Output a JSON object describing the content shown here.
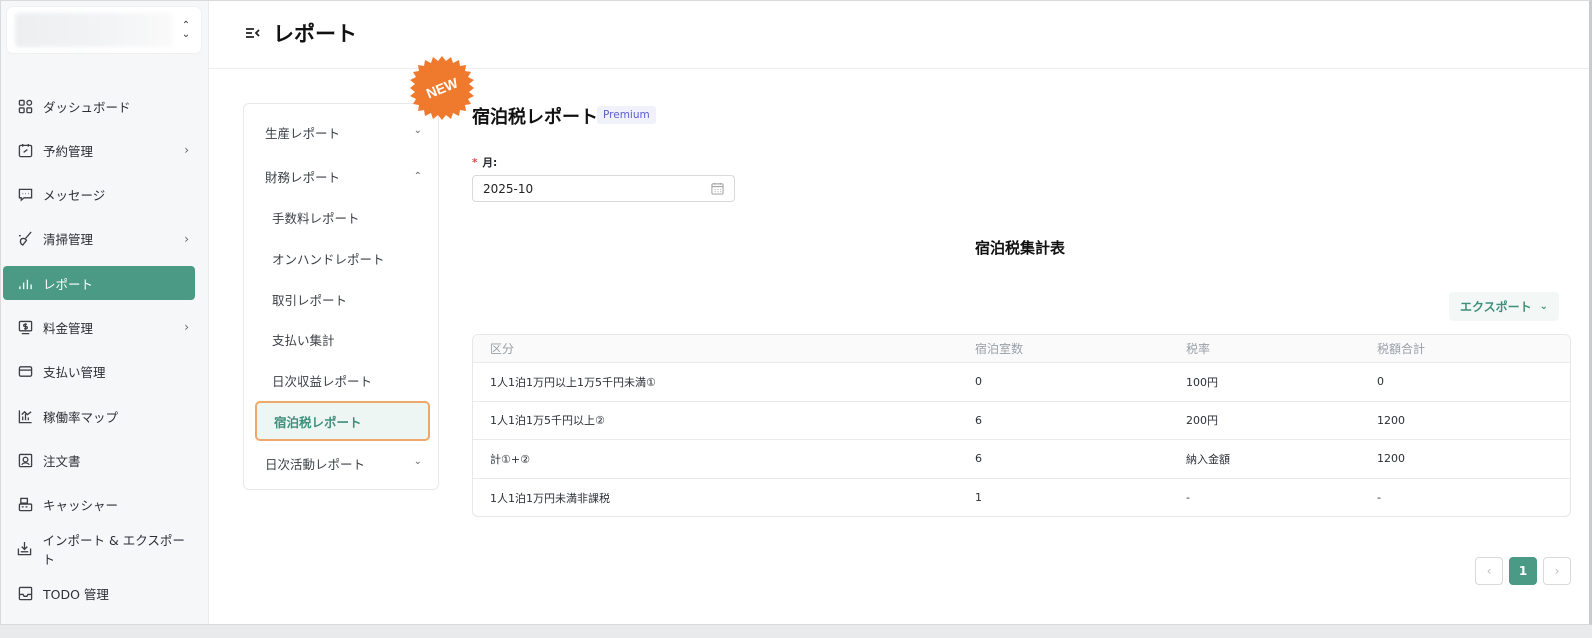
{
  "header": {
    "title": "レポート"
  },
  "sidebar": {
    "items": [
      {
        "label": "ダッシュボード",
        "icon": "dashboard-icon",
        "chevron": false
      },
      {
        "label": "予約管理",
        "icon": "calendar-icon",
        "chevron": true
      },
      {
        "label": "メッセージ",
        "icon": "message-icon",
        "chevron": false
      },
      {
        "label": "清掃管理",
        "icon": "broom-icon",
        "chevron": true
      },
      {
        "label": "レポート",
        "icon": "chart-icon",
        "chevron": false,
        "active": true
      },
      {
        "label": "料金管理",
        "icon": "price-icon",
        "chevron": true
      },
      {
        "label": "支払い管理",
        "icon": "card-icon",
        "chevron": false
      },
      {
        "label": "稼働率マップ",
        "icon": "occupancy-icon",
        "chevron": false
      },
      {
        "label": "注文書",
        "icon": "order-icon",
        "chevron": false
      },
      {
        "label": "キャッシャー",
        "icon": "cashier-icon",
        "chevron": false
      },
      {
        "label": "インポート & エクスポート",
        "icon": "import-export-icon",
        "chevron": false
      },
      {
        "label": "TODO 管理",
        "icon": "todo-icon",
        "chevron": false
      }
    ]
  },
  "submenu": {
    "badge": "NEW",
    "groups": [
      {
        "label": "生産レポート"
      },
      {
        "label": "財務レポート"
      },
      {
        "label": "日次活動レポート"
      }
    ],
    "items": [
      {
        "label": "手数料レポート"
      },
      {
        "label": "オンハンドレポート"
      },
      {
        "label": "取引レポート"
      },
      {
        "label": "支払い集計"
      },
      {
        "label": "日次収益レポート"
      },
      {
        "label": "宿泊税レポート",
        "active": true
      }
    ]
  },
  "main": {
    "title": "宿泊税レポート",
    "badge": "Premium",
    "month_label": "月:",
    "month_value": "2025-10",
    "table_title": "宿泊税集計表",
    "export_label": "エクスポート",
    "columns": [
      "区分",
      "宿泊室数",
      "税率",
      "税額合計"
    ],
    "rows": [
      [
        "1人1泊1万円以上1万5千円未満①",
        "0",
        "100円",
        "0"
      ],
      [
        "1人1泊1万5千円以上②",
        "6",
        "200円",
        "1200"
      ],
      [
        "計①+②",
        "6",
        "納入金額",
        "1200"
      ],
      [
        "1人1泊1万円未満非課税",
        "1",
        "-",
        "-"
      ]
    ],
    "pagination": {
      "prev": "‹",
      "current": "1",
      "next": "›"
    }
  },
  "colors": {
    "accent": "#4a9a85",
    "badge_orange": "#ef7a2e",
    "highlight_border": "#f0a868"
  }
}
